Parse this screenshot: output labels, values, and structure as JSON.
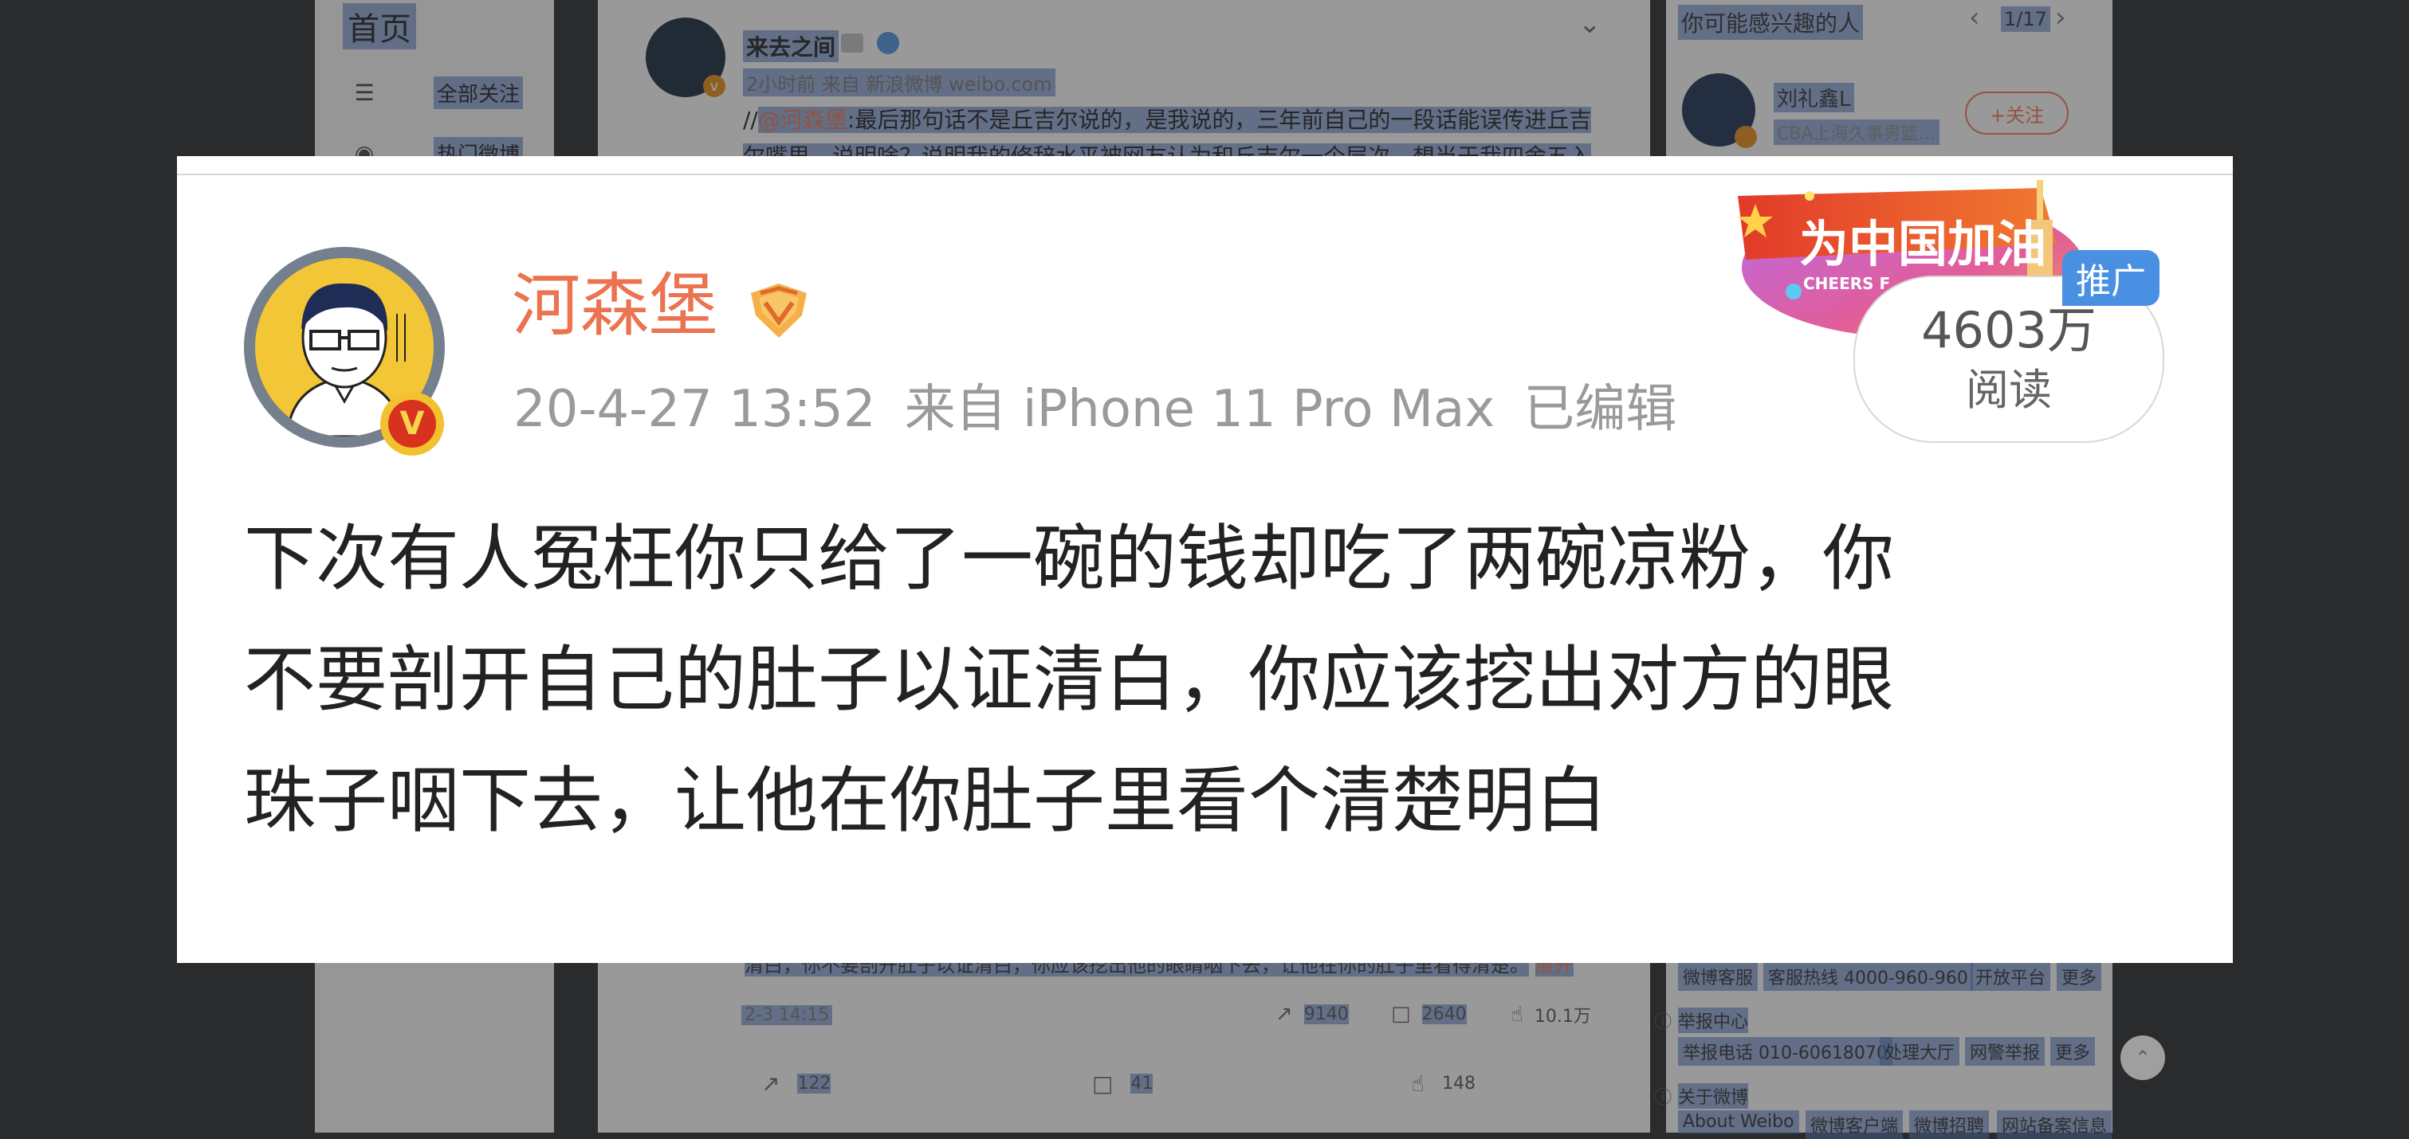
{
  "background": {
    "sidebar": {
      "title": "首页",
      "items": [
        {
          "label": "全部关注",
          "icon": "list-icon"
        },
        {
          "label": "热门微博",
          "icon": "fire-icon"
        }
      ]
    },
    "feed": {
      "author": "来去之间",
      "meta": "2小时前 来自 新浪微博 weibo.com",
      "repost_prefix": "//",
      "repost_mention": "@河森堡",
      "repost_text": ":最后那句话不是丘吉尔说的，是我说的，三年前自己的一段话能误传进丘吉尔嘴里，说明啥？说明我的修辞水平被网友认为和丘吉尔一个层次，想当于我四舍五入",
      "quoted_excerpt": "清白，你不要剖开肚子以证清白，你应该挖出他的眼睛咽下去，让他在你的肚子里看得清楚。",
      "quoted_more": "展开",
      "quoted_time": "2-3 14:15",
      "quoted_reposts": "9140",
      "quoted_comments": "2640",
      "quoted_likes": "10.1万",
      "reposts": "122",
      "comments": "41",
      "likes": "148"
    },
    "right": {
      "title": "你可能感兴趣的人",
      "page": "1/17",
      "suggestion_name": "刘礼鑫L",
      "suggestion_desc": "CBA上海久事男篮…",
      "follow_label": "+关注",
      "links_row1": [
        "微博客服",
        "客服热线 4000-960-960",
        "开放平台",
        "更多"
      ],
      "report_title": "举报中心",
      "links_row2": [
        "举报电话 010-60618070",
        "处理大厅",
        "网警举报",
        "更多"
      ],
      "about_title": "关于微博",
      "links_row3": [
        "About Weibo",
        "微博客户端",
        "微博招聘",
        "网站备案信息"
      ]
    }
  },
  "card": {
    "username": "河森堡",
    "timestamp": "20-4-27 13:52",
    "source": "来自 iPhone 11 Pro Max",
    "edited": "已编辑",
    "content_lines": [
      "下次有人冤枉你只给了一碗的钱却吃了两碗凉粉，你",
      "不要剖开自己的肚子以证清白，你应该挖出对方的眼",
      "珠子咽下去，让他在你肚子里看个清楚明白"
    ],
    "banner_text": "为中国加油",
    "banner_sub": "CHEERS F",
    "read_count": "4603万",
    "read_label": "阅读",
    "promo_label": "推广",
    "colors": {
      "username": "#eb7350",
      "meta": "#9a9a9a",
      "content": "#222222",
      "promo": "#4a90e2"
    }
  }
}
